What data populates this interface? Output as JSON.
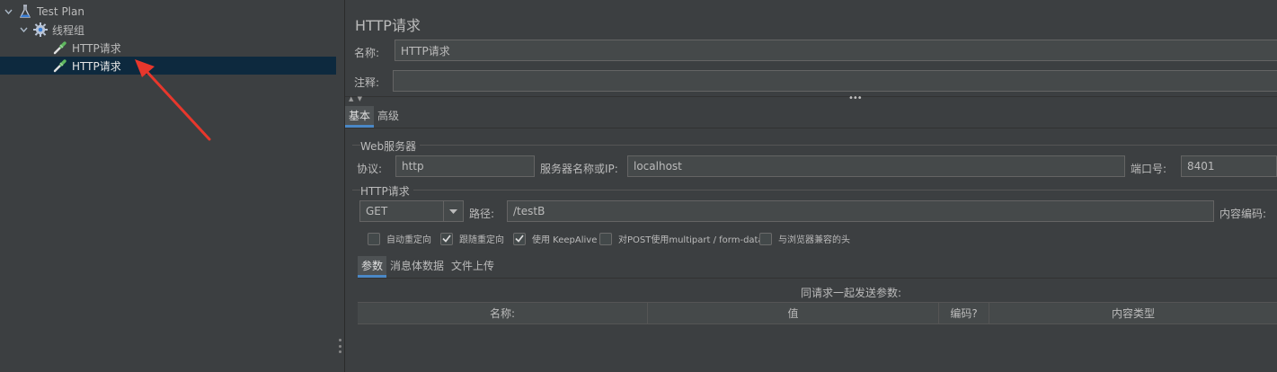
{
  "tree": {
    "items": [
      {
        "label": "Test Plan",
        "icon": "flask-icon",
        "expanded": true
      },
      {
        "label": "线程组",
        "icon": "gear-icon",
        "expanded": true
      },
      {
        "label": "HTTP请求",
        "icon": "pipette-icon"
      },
      {
        "label": "HTTP请求",
        "icon": "pipette-icon",
        "selected": true
      }
    ]
  },
  "panel": {
    "title": "HTTP请求",
    "name_label": "名称:",
    "name_value": "HTTP请求",
    "comment_label": "注释:",
    "comment_value": "",
    "tabs": [
      {
        "label": "基本",
        "active": true
      },
      {
        "label": "高级",
        "active": false
      }
    ],
    "web_server": {
      "group_title": "Web服务器",
      "protocol_label": "协议:",
      "protocol_value": "http",
      "server_label": "服务器名称或IP:",
      "server_value": "localhost",
      "port_label": "端口号:",
      "port_value": "8401"
    },
    "http_request": {
      "group_title": "HTTP请求",
      "method": "GET",
      "path_label": "路径:",
      "path_value": "/testB",
      "encoding_label": "内容编码:"
    },
    "options": [
      {
        "label": "自动重定向",
        "checked": false
      },
      {
        "label": "跟随重定向",
        "checked": true
      },
      {
        "label": "使用 KeepAlive",
        "checked": true
      },
      {
        "label": "对POST使用multipart / form-data",
        "checked": false
      },
      {
        "label": "与浏览器兼容的头",
        "checked": false
      }
    ],
    "sub_tabs": [
      {
        "label": "参数",
        "active": true
      },
      {
        "label": "消息体数据",
        "active": false
      },
      {
        "label": "文件上传",
        "active": false
      }
    ],
    "params_caption": "同请求一起发送参数:",
    "table_headers": [
      "名称:",
      "值",
      "编码?",
      "内容类型"
    ]
  },
  "colors": {
    "background": "#3c3f41",
    "selection": "#0d293e",
    "accent": "#4a88c7",
    "annotation": "#e8372c"
  }
}
